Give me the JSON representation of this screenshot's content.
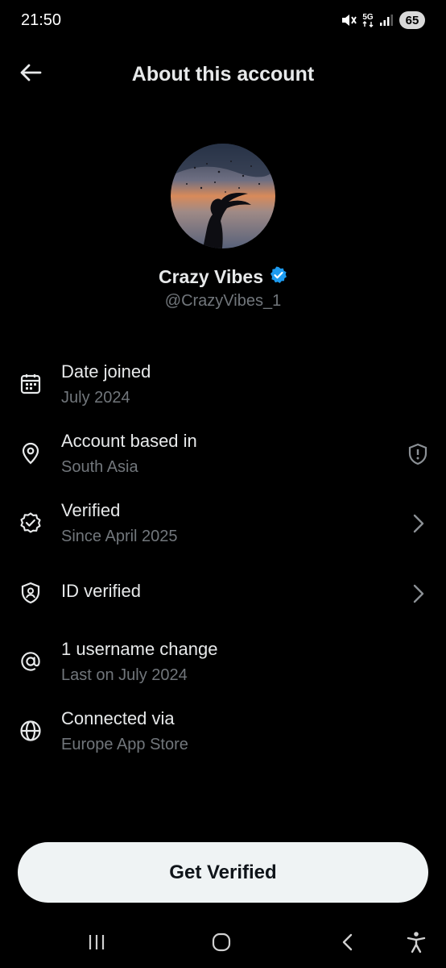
{
  "status_bar": {
    "time": "21:50",
    "network": "5G",
    "battery": "65",
    "icons": [
      "mute-icon",
      "5g-icon",
      "signal-icon",
      "battery-icon"
    ]
  },
  "header": {
    "title": "About this account",
    "back_icon": "arrow-left-icon"
  },
  "profile": {
    "display_name": "Crazy Vibes",
    "handle": "@CrazyVibes_1",
    "verified_badge_color": "#1d9bf0"
  },
  "info": {
    "date_joined": {
      "title": "Date joined",
      "subtitle": "July 2024",
      "icon": "calendar-icon"
    },
    "account_based": {
      "title": "Account based in",
      "subtitle": "South Asia",
      "icon": "location-pin-icon",
      "right_icon": "shield-alert-icon"
    },
    "verified": {
      "title": "Verified",
      "subtitle": "Since April 2025",
      "icon": "verified-badge-icon",
      "right_icon": "chevron-right-icon"
    },
    "id_verified": {
      "title": "ID verified",
      "icon": "id-shield-icon",
      "right_icon": "chevron-right-icon"
    },
    "username_change": {
      "title": "1 username change",
      "subtitle": "Last on July 2024",
      "icon": "at-sign-icon"
    },
    "connected_via": {
      "title": "Connected via",
      "subtitle": "Europe App Store",
      "icon": "globe-icon"
    }
  },
  "cta": {
    "label": "Get Verified"
  },
  "nav_bar": {
    "icons": [
      "recents-icon",
      "home-icon",
      "back-icon",
      "accessibility-icon"
    ]
  },
  "colors": {
    "background": "#000000",
    "primary_text": "#e7e9ea",
    "secondary_text": "#71767b",
    "button_bg": "#eff3f4",
    "accent": "#1d9bf0"
  }
}
